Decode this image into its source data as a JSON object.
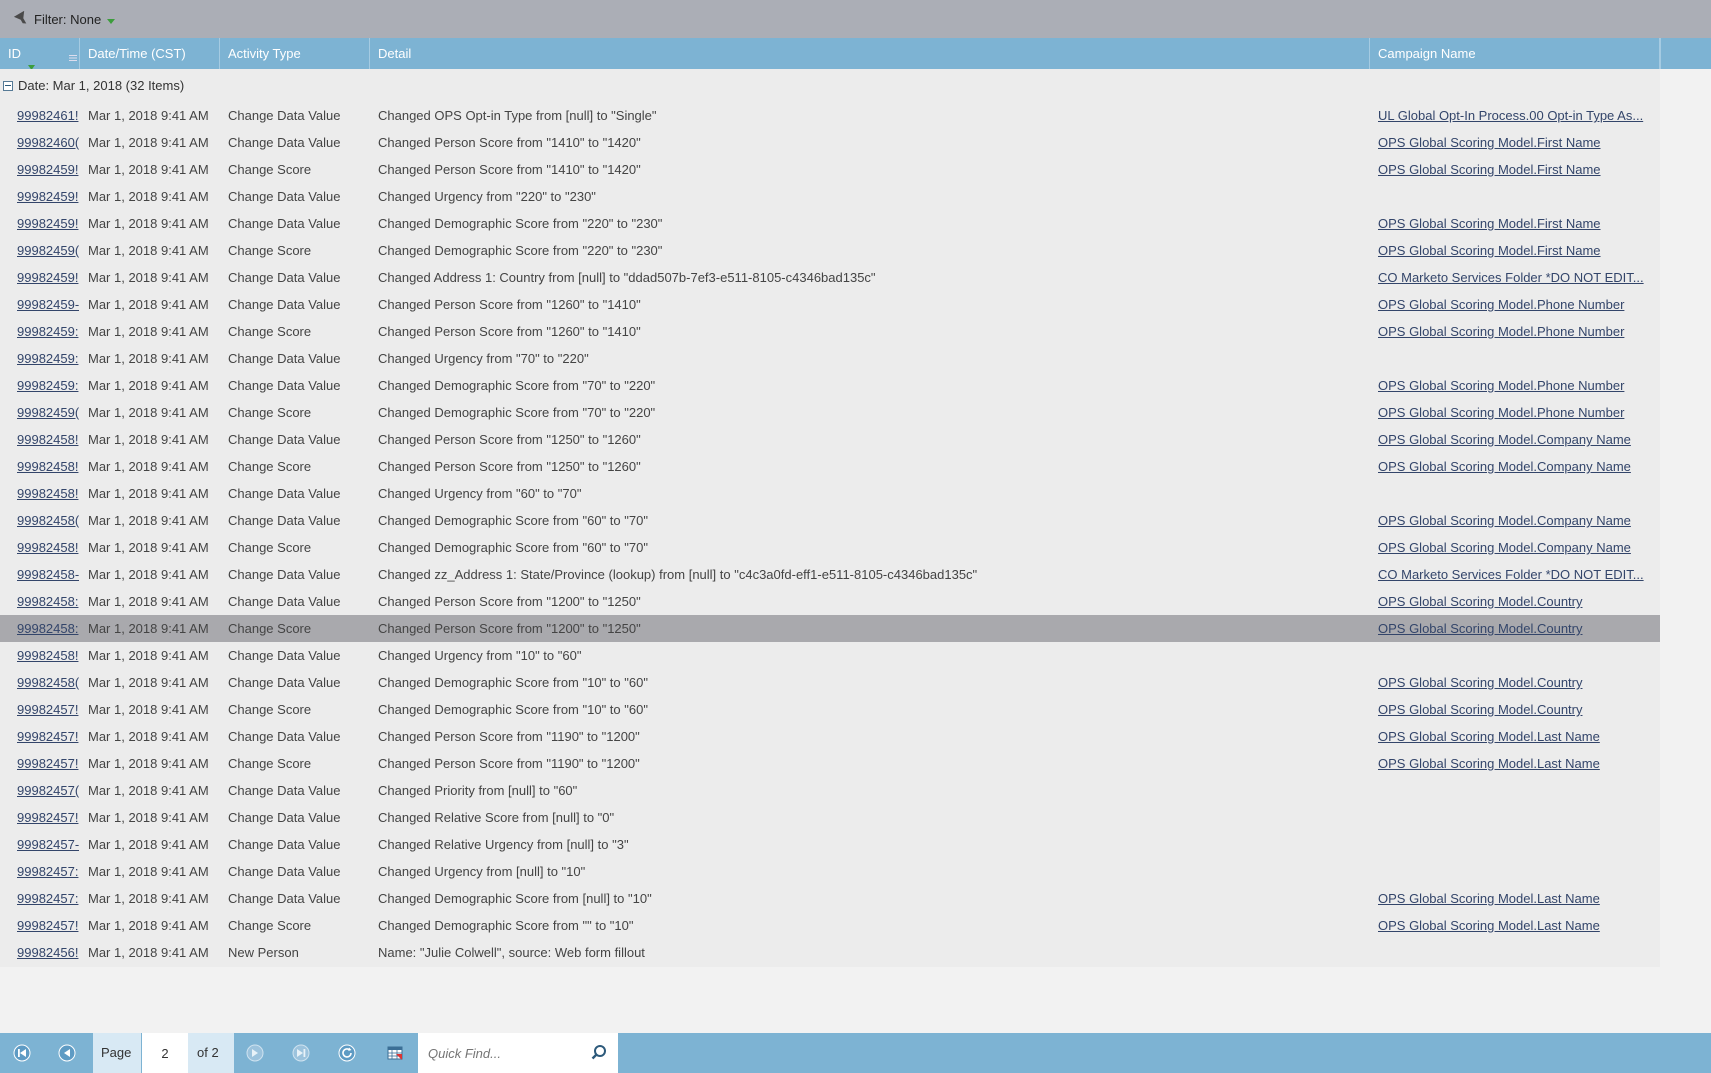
{
  "filter": {
    "label": "Filter: None"
  },
  "columns": {
    "id": "ID",
    "date": "Date/Time (CST)",
    "type": "Activity Type",
    "detail": "Detail",
    "campaign": "Campaign Name"
  },
  "group": {
    "label": "Date: Mar 1, 2018 (32 Items)"
  },
  "rows": [
    {
      "id": "99982461!",
      "date": "Mar 1, 2018 9:41 AM",
      "type": "Change Data Value",
      "detail": "Changed OPS Opt-in Type from [null] to \"Single\"",
      "campaign": "UL Global Opt-In Process.00 Opt-in Type As..."
    },
    {
      "id": "99982460(",
      "date": "Mar 1, 2018 9:41 AM",
      "type": "Change Data Value",
      "detail": "Changed Person Score from \"1410\" to \"1420\"",
      "campaign": "OPS Global Scoring Model.First Name"
    },
    {
      "id": "99982459!",
      "date": "Mar 1, 2018 9:41 AM",
      "type": "Change Score",
      "detail": "Changed Person Score from \"1410\" to \"1420\"",
      "campaign": "OPS Global Scoring Model.First Name"
    },
    {
      "id": "99982459!",
      "date": "Mar 1, 2018 9:41 AM",
      "type": "Change Data Value",
      "detail": "Changed Urgency from \"220\" to \"230\"",
      "campaign": ""
    },
    {
      "id": "99982459!",
      "date": "Mar 1, 2018 9:41 AM",
      "type": "Change Data Value",
      "detail": "Changed Demographic Score from \"220\" to \"230\"",
      "campaign": "OPS Global Scoring Model.First Name"
    },
    {
      "id": "99982459(",
      "date": "Mar 1, 2018 9:41 AM",
      "type": "Change Score",
      "detail": "Changed Demographic Score from \"220\" to \"230\"",
      "campaign": "OPS Global Scoring Model.First Name"
    },
    {
      "id": "99982459!",
      "date": "Mar 1, 2018 9:41 AM",
      "type": "Change Data Value",
      "detail": "Changed Address 1: Country from [null] to \"ddad507b-7ef3-e511-8105-c4346bad135c\"",
      "campaign": "CO Marketo Services Folder *DO NOT EDIT..."
    },
    {
      "id": "99982459-",
      "date": "Mar 1, 2018 9:41 AM",
      "type": "Change Data Value",
      "detail": "Changed Person Score from \"1260\" to \"1410\"",
      "campaign": "OPS Global Scoring Model.Phone Number"
    },
    {
      "id": "99982459:",
      "date": "Mar 1, 2018 9:41 AM",
      "type": "Change Score",
      "detail": "Changed Person Score from \"1260\" to \"1410\"",
      "campaign": "OPS Global Scoring Model.Phone Number"
    },
    {
      "id": "99982459:",
      "date": "Mar 1, 2018 9:41 AM",
      "type": "Change Data Value",
      "detail": "Changed Urgency from \"70\" to \"220\"",
      "campaign": ""
    },
    {
      "id": "99982459:",
      "date": "Mar 1, 2018 9:41 AM",
      "type": "Change Data Value",
      "detail": "Changed Demographic Score from \"70\" to \"220\"",
      "campaign": "OPS Global Scoring Model.Phone Number"
    },
    {
      "id": "99982459(",
      "date": "Mar 1, 2018 9:41 AM",
      "type": "Change Score",
      "detail": "Changed Demographic Score from \"70\" to \"220\"",
      "campaign": "OPS Global Scoring Model.Phone Number"
    },
    {
      "id": "99982458!",
      "date": "Mar 1, 2018 9:41 AM",
      "type": "Change Data Value",
      "detail": "Changed Person Score from \"1250\" to \"1260\"",
      "campaign": "OPS Global Scoring Model.Company Name"
    },
    {
      "id": "99982458!",
      "date": "Mar 1, 2018 9:41 AM",
      "type": "Change Score",
      "detail": "Changed Person Score from \"1250\" to \"1260\"",
      "campaign": "OPS Global Scoring Model.Company Name"
    },
    {
      "id": "99982458!",
      "date": "Mar 1, 2018 9:41 AM",
      "type": "Change Data Value",
      "detail": "Changed Urgency from \"60\" to \"70\"",
      "campaign": ""
    },
    {
      "id": "99982458(",
      "date": "Mar 1, 2018 9:41 AM",
      "type": "Change Data Value",
      "detail": "Changed Demographic Score from \"60\" to \"70\"",
      "campaign": "OPS Global Scoring Model.Company Name"
    },
    {
      "id": "99982458!",
      "date": "Mar 1, 2018 9:41 AM",
      "type": "Change Score",
      "detail": "Changed Demographic Score from \"60\" to \"70\"",
      "campaign": "OPS Global Scoring Model.Company Name"
    },
    {
      "id": "99982458-",
      "date": "Mar 1, 2018 9:41 AM",
      "type": "Change Data Value",
      "detail": "Changed zz_Address 1: State/Province (lookup) from [null] to \"c4c3a0fd-eff1-e511-8105-c4346bad135c\"",
      "campaign": "CO Marketo Services Folder *DO NOT EDIT..."
    },
    {
      "id": "99982458:",
      "date": "Mar 1, 2018 9:41 AM",
      "type": "Change Data Value",
      "detail": "Changed Person Score from \"1200\" to \"1250\"",
      "campaign": "OPS Global Scoring Model.Country"
    },
    {
      "id": "99982458:",
      "date": "Mar 1, 2018 9:41 AM",
      "type": "Change Score",
      "detail": "Changed Person Score from \"1200\" to \"1250\"",
      "campaign": "OPS Global Scoring Model.Country",
      "selected": true
    },
    {
      "id": "99982458!",
      "date": "Mar 1, 2018 9:41 AM",
      "type": "Change Data Value",
      "detail": "Changed Urgency from \"10\" to \"60\"",
      "campaign": ""
    },
    {
      "id": "99982458(",
      "date": "Mar 1, 2018 9:41 AM",
      "type": "Change Data Value",
      "detail": "Changed Demographic Score from \"10\" to \"60\"",
      "campaign": "OPS Global Scoring Model.Country"
    },
    {
      "id": "99982457!",
      "date": "Mar 1, 2018 9:41 AM",
      "type": "Change Score",
      "detail": "Changed Demographic Score from \"10\" to \"60\"",
      "campaign": "OPS Global Scoring Model.Country"
    },
    {
      "id": "99982457!",
      "date": "Mar 1, 2018 9:41 AM",
      "type": "Change Data Value",
      "detail": "Changed Person Score from \"1190\" to \"1200\"",
      "campaign": "OPS Global Scoring Model.Last Name"
    },
    {
      "id": "99982457!",
      "date": "Mar 1, 2018 9:41 AM",
      "type": "Change Score",
      "detail": "Changed Person Score from \"1190\" to \"1200\"",
      "campaign": "OPS Global Scoring Model.Last Name"
    },
    {
      "id": "99982457(",
      "date": "Mar 1, 2018 9:41 AM",
      "type": "Change Data Value",
      "detail": "Changed Priority from [null] to \"60\"",
      "campaign": ""
    },
    {
      "id": "99982457!",
      "date": "Mar 1, 2018 9:41 AM",
      "type": "Change Data Value",
      "detail": "Changed Relative Score from [null] to \"0\"",
      "campaign": ""
    },
    {
      "id": "99982457-",
      "date": "Mar 1, 2018 9:41 AM",
      "type": "Change Data Value",
      "detail": "Changed Relative Urgency from [null] to \"3\"",
      "campaign": ""
    },
    {
      "id": "99982457:",
      "date": "Mar 1, 2018 9:41 AM",
      "type": "Change Data Value",
      "detail": "Changed Urgency from [null] to \"10\"",
      "campaign": ""
    },
    {
      "id": "99982457:",
      "date": "Mar 1, 2018 9:41 AM",
      "type": "Change Data Value",
      "detail": "Changed Demographic Score from [null] to \"10\"",
      "campaign": "OPS Global Scoring Model.Last Name"
    },
    {
      "id": "99982457!",
      "date": "Mar 1, 2018 9:41 AM",
      "type": "Change Score",
      "detail": "Changed Demographic Score from \"\" to \"10\"",
      "campaign": "OPS Global Scoring Model.Last Name"
    },
    {
      "id": "99982456!",
      "date": "Mar 1, 2018 9:41 AM",
      "type": "New Person",
      "detail": "Name: \"Julie Colwell\", source: Web form fillout",
      "campaign": ""
    }
  ],
  "pager": {
    "page_label": "Page",
    "page_value": "2",
    "of_label": "of 2",
    "quick_find_placeholder": "Quick Find..."
  },
  "colors": {
    "header": "#7db3d3",
    "filter_bar": "#abaeb6",
    "selected_row": "#a9a9ad",
    "link": "#33456a"
  },
  "icons": {
    "filter": "funnel-icon",
    "filter_dropdown": "chevron-down-icon",
    "sort": "sort-desc-icon",
    "first": "first-page-icon",
    "prev": "prev-page-icon",
    "next": "next-page-icon",
    "last": "last-page-icon",
    "refresh": "refresh-icon",
    "export": "export-icon",
    "search": "search-icon"
  }
}
